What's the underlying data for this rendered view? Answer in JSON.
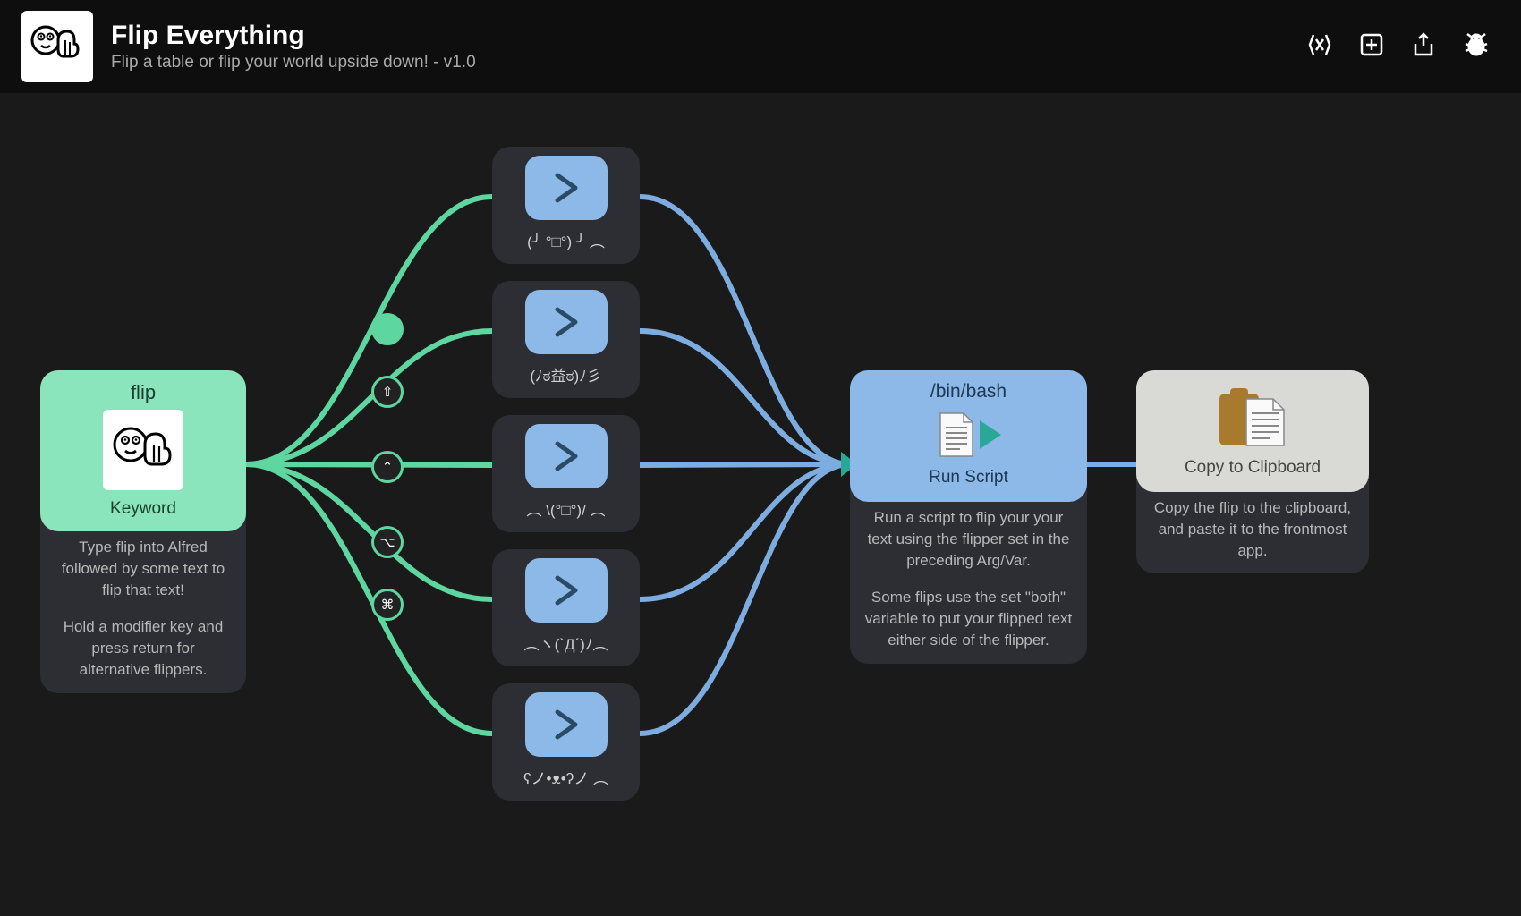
{
  "header": {
    "title": "Flip Everything",
    "subtitle": "Flip a table or flip your world upside down! - v1.0"
  },
  "keyword": {
    "title": "flip",
    "label": "Keyword",
    "desc1": "Type flip into Alfred followed by some text to flip that text!",
    "desc2": "Hold a modifier key and press return for alternative flippers."
  },
  "argvars": [
    {
      "label": "(╯ °□°) ╯ ︵"
    },
    {
      "label": "(ﾉಠ益ಠ)ﾉ彡"
    },
    {
      "label": "︵ \\(°□°)/ ︵"
    },
    {
      "label": "︵ヽ(`Д´)ﾉ︵"
    },
    {
      "label": "ʕノ•ᴥ•ʔノ ︵"
    }
  ],
  "modifiers": {
    "shift": "⇧",
    "ctrl": "⌃",
    "option": "⌥",
    "cmd": "⌘"
  },
  "script": {
    "title": "/bin/bash",
    "label": "Run Script",
    "desc1": "Run a script to flip your your text using the flipper set in the preceding Arg/Var.",
    "desc2": "Some flips use the set \"both\" variable to put your flipped text either side of the flipper."
  },
  "clipboard": {
    "label": "Copy to Clipboard",
    "desc": "Copy the flip to the clipboard, and paste it to the frontmost app."
  }
}
